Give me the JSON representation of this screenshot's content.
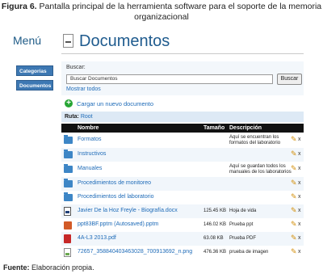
{
  "caption": {
    "label": "Figura 6.",
    "text_line1": "Pantalla principal de la herramienta software para el soporte de la memoria",
    "text_line2": "organizacional"
  },
  "sidebar": {
    "title": "Menú",
    "items": [
      {
        "label": "Categorías"
      },
      {
        "label": "Documentos"
      }
    ]
  },
  "header": {
    "title": "Documentos"
  },
  "search": {
    "label": "Buscar:",
    "value": "Buscar Documentos",
    "button_label": "Buscar",
    "show_all_label": "Mostrar todos"
  },
  "upload": {
    "label": "Cargar un nuevo documento"
  },
  "route": {
    "label": "Ruta:",
    "value": "Root"
  },
  "table": {
    "columns": {
      "name": "Nombre",
      "size": "Tamaño",
      "description": "Descripción"
    },
    "rows": [
      {
        "type": "folder",
        "name": "Formatos",
        "size": "",
        "description": "Aquí se encuentran los formatos del laboratorio"
      },
      {
        "type": "folder",
        "name": "Instructivos",
        "size": "",
        "description": ""
      },
      {
        "type": "folder",
        "name": "Manuales",
        "size": "",
        "description": "Aquí se guardan todos los manuales de los laboratorios"
      },
      {
        "type": "folder",
        "name": "Procedimientos de monitoreo",
        "size": "",
        "description": ""
      },
      {
        "type": "folder",
        "name": "Procedimientos del laboratorio",
        "size": "",
        "description": ""
      },
      {
        "type": "word",
        "name": "Javier De la Hoz Freyle - Biografía.docx",
        "size": "125.45 KB",
        "description": "Hoja de vida"
      },
      {
        "type": "ppt",
        "name": "ppt83BF.pptm (Autosaved).pptm",
        "size": "146.02 KB",
        "description": "Prueba ppt"
      },
      {
        "type": "pdf",
        "name": "4A-L3 2013.pdf",
        "size": "63.08 KB",
        "description": "Prueba PDF"
      },
      {
        "type": "png",
        "name": "72657_358840403463028_700913692_n.png",
        "size": "476.36 KB",
        "description": "prueba de imagen"
      }
    ],
    "delete_label": "x"
  },
  "source": {
    "label": "Fuente:",
    "text": "Elaboración propia."
  }
}
